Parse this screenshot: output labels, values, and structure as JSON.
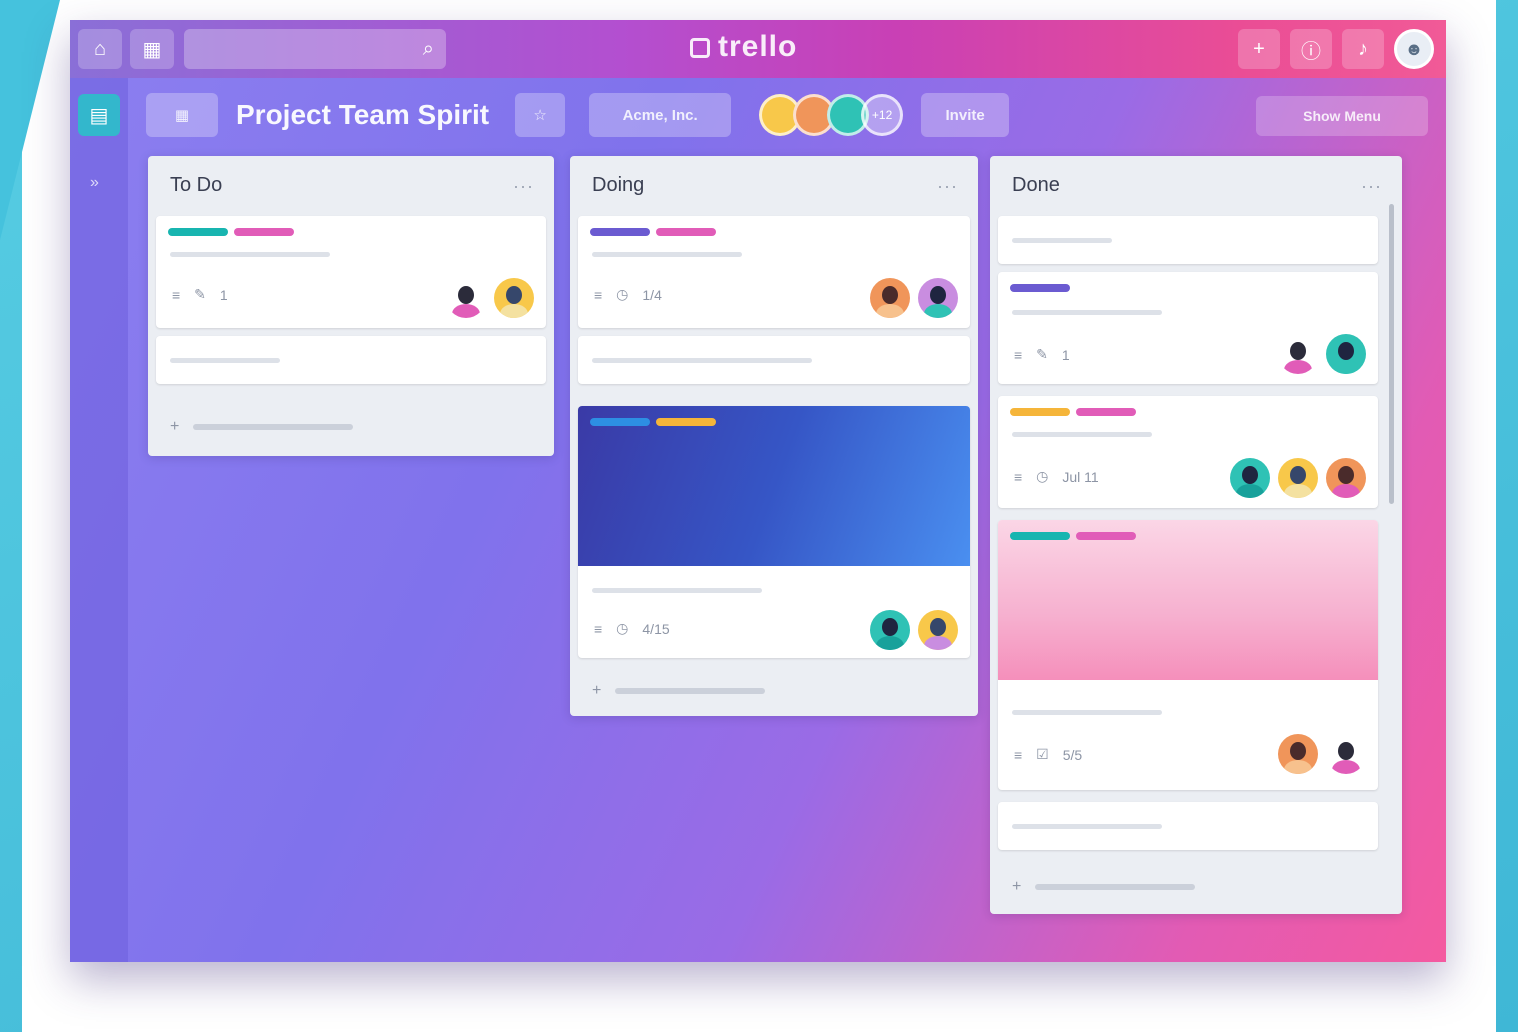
{
  "app": {
    "logo_text": "trello"
  },
  "board": {
    "title": "Project Team Spirit",
    "team_button": "Acme, Inc.",
    "invite_button": "Invite",
    "extra_members_label": "+12",
    "menu_button": "Show Menu"
  },
  "colors": {
    "label_teal": "#18b5b0",
    "label_pink": "#e15cb8",
    "label_purple": "#6b5bd1",
    "label_blue": "#2d8fe3",
    "label_yellow": "#f5b53a",
    "avatar_yellow": "#f8c84a",
    "avatar_orange": "#f0955a",
    "avatar_teal": "#2fc2b5",
    "avatar_purple": "#c98de0",
    "avatar_pink": "#f29ec6"
  },
  "lists": [
    {
      "title": "To Do",
      "cards": [
        {
          "labels": [
            "label_teal",
            "label_pink"
          ],
          "comments": "",
          "attachments": "1",
          "avatars": [
            "avatar_pink",
            "avatar_yellow"
          ]
        },
        {
          "labels": []
        }
      ],
      "add_card": ""
    },
    {
      "title": "Doing",
      "cards": [
        {
          "labels": [
            "label_purple",
            "label_pink"
          ],
          "due": "1/4",
          "avatars": [
            "avatar_orange",
            "avatar_purple"
          ]
        },
        {
          "labels": [
            "label_blue",
            "label_yellow"
          ],
          "due": "4/15",
          "avatars": [
            "avatar_teal",
            "avatar_yellow"
          ]
        }
      ],
      "add_card": ""
    },
    {
      "title": "Done",
      "cards": [
        {
          "labels": []
        },
        {
          "labels": [
            "label_purple"
          ],
          "attachments": "1",
          "avatars": [
            "avatar_pink",
            "avatar_teal"
          ]
        },
        {
          "labels": [
            "label_yellow",
            "label_pink"
          ],
          "due": "Jul 11",
          "avatars": [
            "avatar_teal",
            "avatar_yellow",
            "avatar_orange"
          ]
        },
        {
          "labels": [
            "label_teal",
            "label_pink"
          ],
          "checklist": "5/5",
          "avatars": [
            "avatar_orange",
            "avatar_pink"
          ]
        }
      ],
      "add_card": ""
    }
  ]
}
